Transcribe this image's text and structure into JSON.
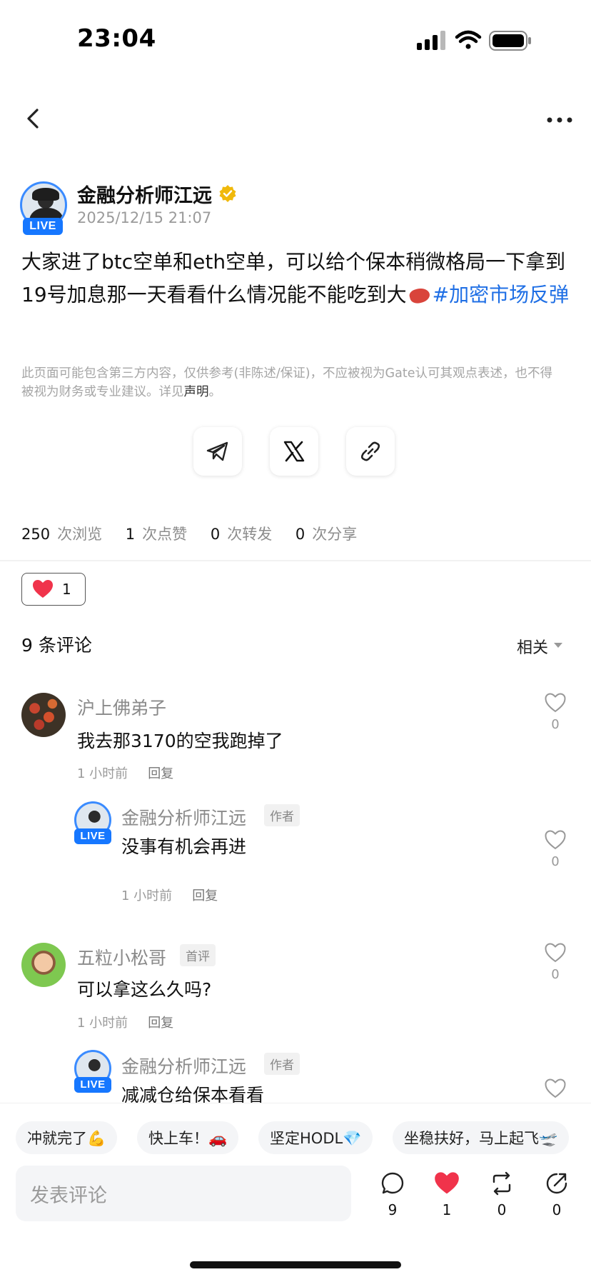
{
  "status": {
    "time": "23:04"
  },
  "post": {
    "author": "金融分析师江远",
    "live_label": "LIVE",
    "date": "2025/12/15 21:07",
    "body": "大家进了btc空单和eth空单，可以给个保本稍微格局一下拿到19号加息那一天看看什么情况能不能吃到大",
    "hashtag": "#加密市场反弹",
    "disclaimer": "此页面可能包含第三方内容，仅供参考(非陈述/保证)，不应被视为Gate认可其观点表述，也不得被视为财务或专业建议。详见",
    "disclaimer_link": "声明",
    "disclaimer_end": "。"
  },
  "share": [
    "telegram-icon",
    "x-icon",
    "link-icon"
  ],
  "stats": {
    "views": "250",
    "views_label": "次浏览",
    "likes": "1",
    "likes_label": "次点赞",
    "reposts": "0",
    "reposts_label": "次转发",
    "shares": "0",
    "shares_label": "次分享"
  },
  "like_pill": {
    "count": "1"
  },
  "comments": {
    "title": "9 条评论",
    "sort": "相关",
    "items": [
      {
        "name": "沪上佛弟子",
        "text": "我去那3170的空我跑掉了",
        "time": "1 小时前",
        "reply": "回复",
        "likes": "0"
      },
      {
        "name": "金融分析师江远",
        "tag": "作者",
        "text": "没事有机会再进",
        "time": "1 小时前",
        "reply": "回复",
        "likes": "0"
      },
      {
        "name": "五粒小松哥",
        "tag": "首评",
        "text": "可以拿这么久吗?",
        "time": "1 小时前",
        "reply": "回复",
        "likes": "0"
      },
      {
        "name": "金融分析师江远",
        "tag": "作者",
        "text": "减减仓给保本看看"
      }
    ]
  },
  "chips": [
    "冲就完了💪",
    "快上车！🚗",
    "坚定HODL💎",
    "坐稳扶好，马上起飞🛫"
  ],
  "input": {
    "placeholder": "发表评论"
  },
  "actions": {
    "comments": "9",
    "likes": "1",
    "reposts": "0",
    "shares": "0"
  },
  "colors": {
    "accent": "#1677ff",
    "hashtag": "#1f6fe5",
    "like": "#f0334b"
  }
}
